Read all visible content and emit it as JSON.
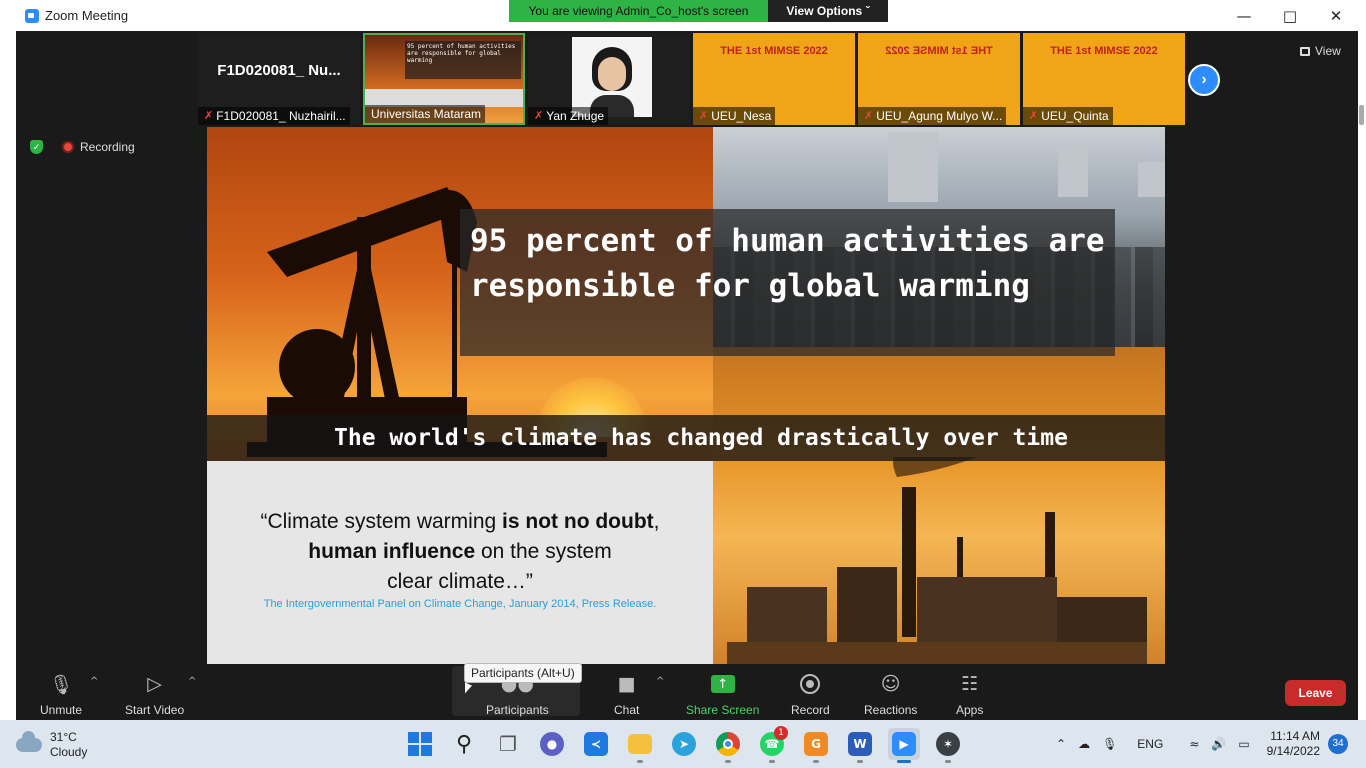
{
  "window": {
    "title": "Zoom Meeting"
  },
  "banner": {
    "viewing": "You are viewing Admin_Co_host's screen",
    "options": "View Options"
  },
  "gallery": {
    "self_name_big": "F1D020081_ Nu...",
    "tiles": [
      {
        "name": "F1D020081_ Nuzhairil..."
      },
      {
        "name": "Universitas Mataram"
      },
      {
        "name": "Yan Zhuge"
      },
      {
        "name": "UEU_Nesa"
      },
      {
        "name": "UEU_Agung Mulyo W..."
      },
      {
        "name": "UEU_Quinta"
      }
    ],
    "mimse_title": "THE 1st MIMSE 2022",
    "view_label": "View"
  },
  "status": {
    "recording": "Recording"
  },
  "slide": {
    "headline": "95 percent of human activities are responsible for global warming",
    "subtitle": "The world's climate has changed drastically over time",
    "quote_parts": {
      "p1": "“Climate system warming ",
      "b1": "is not no doubt",
      "p2": ",",
      "b2": "human influence",
      "p3": " on the system",
      "p4": "clear climate…”"
    },
    "source": "The Intergovernmental Panel on Climate Change, January 2014, Press Release."
  },
  "toolbar": {
    "unmute": "Unmute",
    "start_video": "Start Video",
    "participants": "Participants",
    "participants_tooltip": "Participants (Alt+U)",
    "chat": "Chat",
    "share_screen": "Share Screen",
    "record": "Record",
    "reactions": "Reactions",
    "apps": "Apps",
    "leave": "Leave"
  },
  "taskbar": {
    "temperature": "31°C",
    "weather": "Cloudy",
    "whatsapp_badge": "1",
    "language": "ENG",
    "time": "11:14 AM",
    "date": "9/14/2022",
    "notifications": "34"
  }
}
